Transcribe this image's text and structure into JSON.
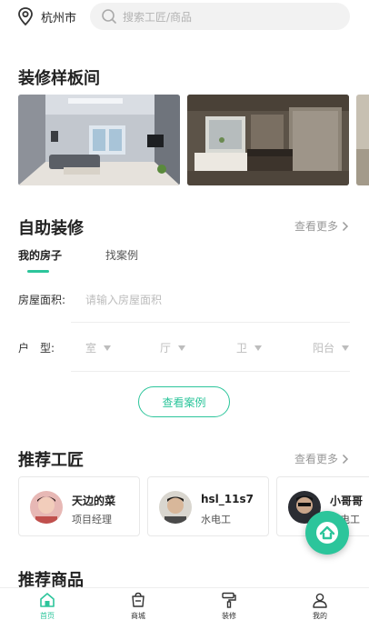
{
  "header": {
    "location": "杭州市",
    "search_placeholder": "搜索工匠/商品"
  },
  "showcase": {
    "title": "装修样板间"
  },
  "diy": {
    "title": "自助装修",
    "more": "查看更多",
    "tabs": [
      "我的房子",
      "找案例"
    ],
    "area_label": "房屋面积:",
    "area_placeholder": "请输入房屋面积",
    "layout_label": "户　型:",
    "layout_options": [
      "室",
      "厅",
      "卫",
      "阳台"
    ],
    "case_button": "查看案例"
  },
  "craftsmen": {
    "title": "推荐工匠",
    "more": "查看更多",
    "items": [
      {
        "name": "天边的菜",
        "role": "项目经理"
      },
      {
        "name": "hsl_11s7",
        "role": "水电工"
      },
      {
        "name": "小哥哥",
        "role": "水电工"
      }
    ]
  },
  "products": {
    "title": "推荐商品"
  },
  "nav": {
    "items": [
      {
        "label": "首页",
        "icon": "home-icon",
        "active": true
      },
      {
        "label": "商城",
        "icon": "shop-icon",
        "active": false
      },
      {
        "label": "装修",
        "icon": "paint-roller-icon",
        "active": false
      },
      {
        "label": "我的",
        "icon": "user-icon",
        "active": false
      }
    ]
  },
  "colors": {
    "accent": "#2cc59b",
    "text": "#222222",
    "muted": "#999999"
  }
}
